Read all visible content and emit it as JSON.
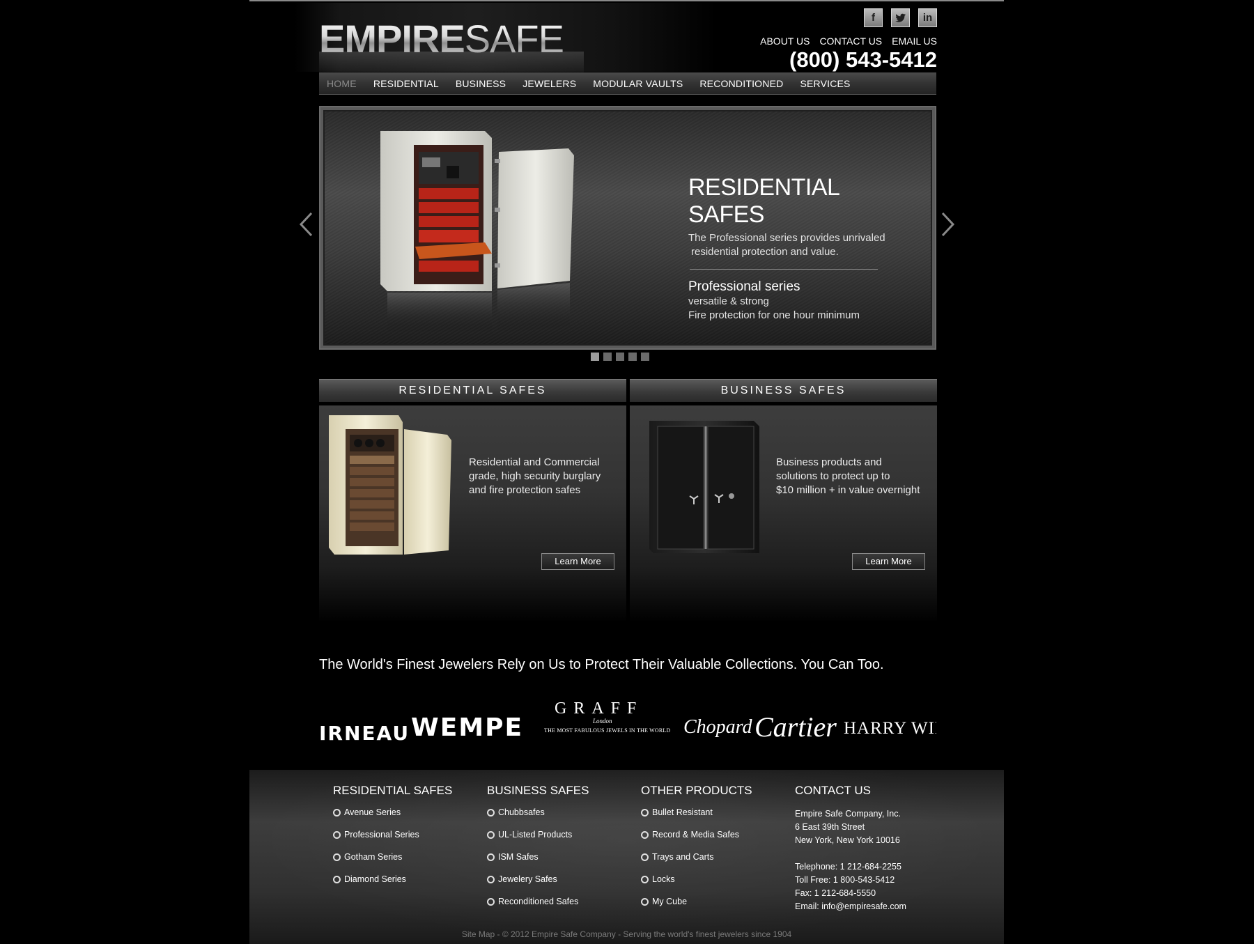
{
  "header": {
    "logo_bold": "EMPIRE",
    "logo_light": "SAFE",
    "social": [
      {
        "label": "f",
        "icon": "facebook-icon"
      },
      {
        "label": "t",
        "icon": "twitter-icon"
      },
      {
        "label": "in",
        "icon": "linkedin-icon"
      }
    ],
    "links": [
      "ABOUT US",
      "CONTACT US",
      "EMAIL US"
    ],
    "phone": "(800) 543-5412"
  },
  "nav": {
    "items": [
      "HOME",
      "RESIDENTIAL",
      "BUSINESS",
      "JEWELERS",
      "MODULAR VAULTS",
      "RECONDITIONED",
      "SERVICES"
    ],
    "active": "HOME"
  },
  "slider": {
    "title": "RESIDENTIAL SAFES",
    "subtitle_1": "The Professional series provides unrivaled",
    "subtitle_2": "residential protection and value.",
    "series": "Professional series",
    "line_1": "versatile & strong",
    "line_2": "Fire protection for one hour minimum",
    "slide_count": 5,
    "active_slide": 1
  },
  "panels": {
    "residential": {
      "title": "RESIDENTIAL SAFES",
      "desc_1": "Residential and Commercial",
      "desc_2": "grade, high security burglary",
      "desc_3": "and fire protection safes",
      "button": "Learn More"
    },
    "business": {
      "title": "BUSINESS SAFES",
      "desc_1": "Business products and",
      "desc_2": "solutions to protect up to",
      "desc_3": "$10 million + in value overnight",
      "button": "Learn More"
    }
  },
  "tagline": "The World's Finest Jewelers Rely on Us to Protect Their Valuable Collections. You Can Too.",
  "brands": {
    "b1": "IRNEAU",
    "b2": "WEMPE",
    "b3_main": "GRAFF",
    "b3_city": "London",
    "b3_sub": "THE MOST FABULOUS JEWELS IN THE WORLD",
    "b4": "Chopard",
    "b5": "Cartier",
    "b6": "HARRY WIN"
  },
  "footer": {
    "col1": {
      "title": "RESIDENTIAL SAFES",
      "items": [
        "Avenue Series",
        "Professional Series",
        "Gotham Series",
        "Diamond Series"
      ]
    },
    "col2": {
      "title": "BUSINESS SAFES",
      "items": [
        "Chubbsafes",
        "UL-Listed Products",
        "ISM Safes",
        "Jewelery Safes",
        "Reconditioned Safes"
      ]
    },
    "col3": {
      "title": "OTHER PRODUCTS",
      "items": [
        "Bullet Resistant",
        "Record & Media Safes",
        "Trays and Carts",
        "Locks",
        "My Cube"
      ]
    },
    "contact": {
      "title": "CONTACT US",
      "company": "Empire Safe Company, Inc.",
      "street": "6 East 39th Street",
      "city": "New York, New York 10016",
      "telephone": "Telephone: 1 212-684-2255",
      "tollfree": "Toll Free: 1 800-543-5412",
      "fax": "Fax: 1 212-684-5550",
      "email": "Email: info@empiresafe.com"
    },
    "copyright": "Site Map - © 2012 Empire Safe Company - Serving the world's finest jewelers since 1904"
  }
}
